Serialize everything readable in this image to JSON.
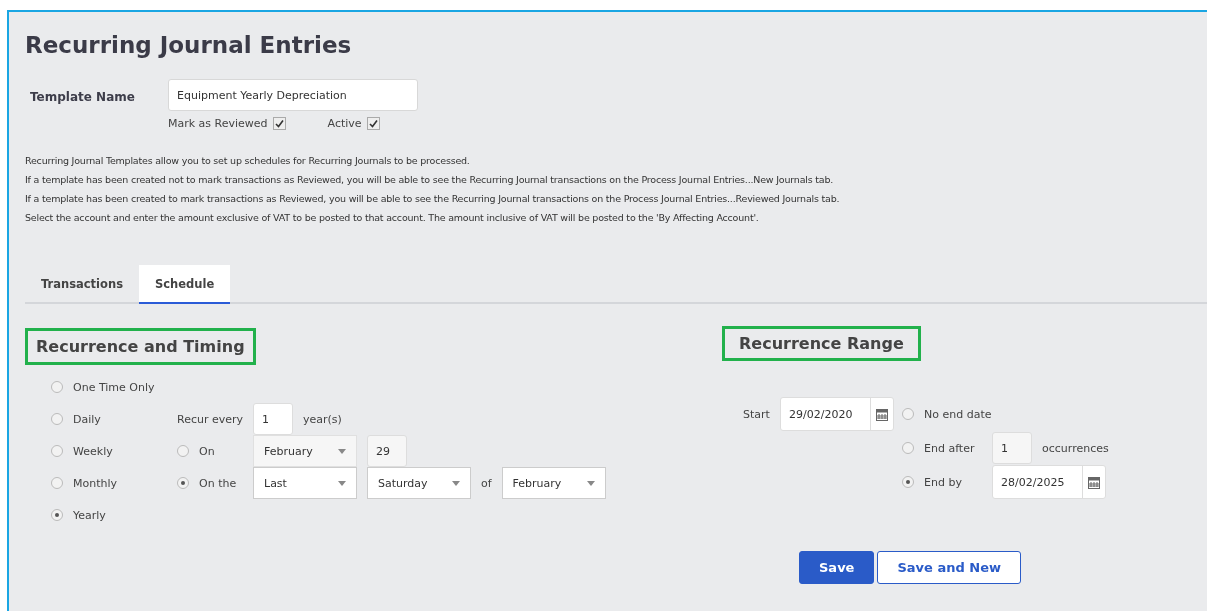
{
  "title": "Recurring Journal Entries",
  "template_name": {
    "label": "Template Name",
    "value": "Equipment Yearly Depreciation"
  },
  "checkboxes": [
    {
      "label": "Mark as Reviewed",
      "checked": true
    },
    {
      "label": "Active",
      "checked": true
    }
  ],
  "info_lines": [
    "Recurring Journal Templates allow you to set up schedules for Recurring Journals to be processed.",
    "If a template has been created not to mark transactions as Reviewed, you will be able to see the Recurring Journal transactions on the Process Journal Entries...New Journals tab.",
    "If a template has been created to mark transactions as Reviewed, you will be able to see the Recurring Journal transactions on the Process Journal Entries...Reviewed Journals tab.",
    "Select the account and enter the amount exclusive of VAT to be posted to that account. The amount inclusive of VAT will be posted to the 'By Affecting Account'."
  ],
  "tabs": [
    {
      "label": "Transactions",
      "selected": false
    },
    {
      "label": "Schedule",
      "selected": true
    }
  ],
  "recurrence_timing": {
    "heading": "Recurrence and Timing",
    "patterns": [
      {
        "label": "One Time Only",
        "selected": false
      },
      {
        "label": "Daily",
        "selected": false
      },
      {
        "label": "Weekly",
        "selected": false
      },
      {
        "label": "Monthly",
        "selected": false
      },
      {
        "label": "Yearly",
        "selected": true
      }
    ],
    "recur_every": {
      "label": "Recur every",
      "value": "1",
      "unit": "year(s)"
    },
    "on_date": {
      "label": "On",
      "selected": false,
      "month": "February",
      "day": "29"
    },
    "on_the": {
      "label": "On the",
      "selected": true,
      "ordinal": "Last",
      "weekday": "Saturday",
      "of_label": "of",
      "month": "February"
    }
  },
  "recurrence_range": {
    "heading": "Recurrence Range",
    "start_label": "Start",
    "start_date": "29/02/2020",
    "end_options": [
      {
        "kind": "none",
        "label": "No end date",
        "selected": false
      },
      {
        "kind": "count",
        "label": "End after",
        "selected": false,
        "value": "1",
        "unit": "occurrences"
      },
      {
        "kind": "date",
        "label": "End by",
        "selected": true,
        "value": "28/02/2025"
      }
    ]
  },
  "buttons": [
    {
      "kind": "primary",
      "label": "Save"
    },
    {
      "kind": "secondary",
      "label": "Save and New"
    }
  ]
}
